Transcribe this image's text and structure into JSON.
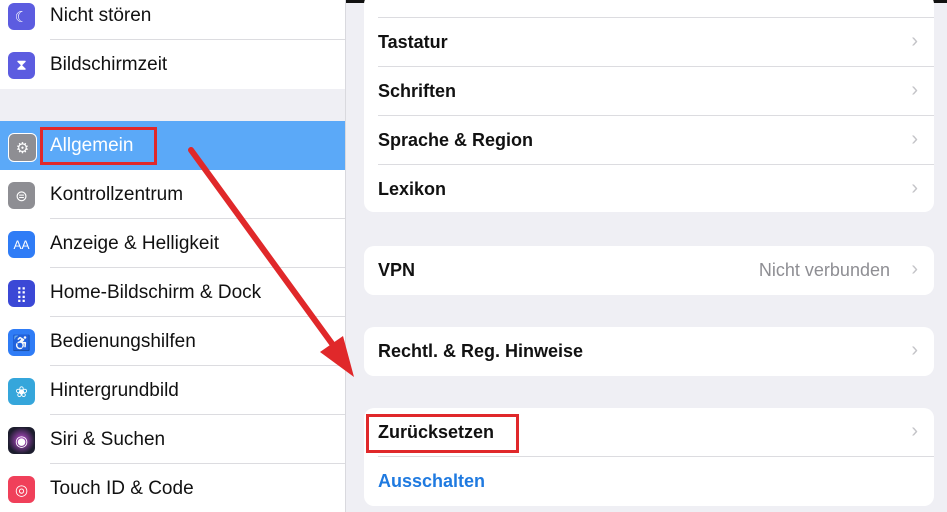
{
  "sidebar": {
    "items": [
      {
        "label": "Nicht stören",
        "icon": "moon-icon",
        "color": "#5c5ce0"
      },
      {
        "label": "Bildschirmzeit",
        "icon": "hourglass-icon",
        "color": "#5c5ce0"
      },
      {
        "label": "Allgemein",
        "icon": "gear-icon",
        "color": "#8e8e93",
        "selected": true
      },
      {
        "label": "Kontrollzentrum",
        "icon": "toggles-icon",
        "color": "#8e8e93"
      },
      {
        "label": "Anzeige & Helligkeit",
        "icon": "text-size-icon",
        "color": "#2f7cf6"
      },
      {
        "label": "Home-Bildschirm & Dock",
        "icon": "grid-icon",
        "color": "#3b48d6"
      },
      {
        "label": "Bedienungshilfen",
        "icon": "accessibility-icon",
        "color": "#2f7cf6"
      },
      {
        "label": "Hintergrundbild",
        "icon": "flower-icon",
        "color": "#35a6db"
      },
      {
        "label": "Siri & Suchen",
        "icon": "siri-icon",
        "color": "#222"
      },
      {
        "label": "Touch ID & Code",
        "icon": "fingerprint-icon",
        "color": "#f0405a"
      }
    ]
  },
  "panel": {
    "group1": [
      {
        "label": "Tastatur"
      },
      {
        "label": "Schriften"
      },
      {
        "label": "Sprache & Region"
      },
      {
        "label": "Lexikon"
      }
    ],
    "vpn": {
      "label": "VPN",
      "value": "Nicht verbunden"
    },
    "legal": {
      "label": "Rechtl. & Reg. Hinweise"
    },
    "reset": {
      "label": "Zurücksetzen"
    },
    "shutdown": {
      "label": "Ausschalten"
    }
  },
  "colors": {
    "highlight": "#e0282a",
    "selected": "#5ba9f8",
    "link": "#1f7ae0"
  },
  "chevron": "›"
}
